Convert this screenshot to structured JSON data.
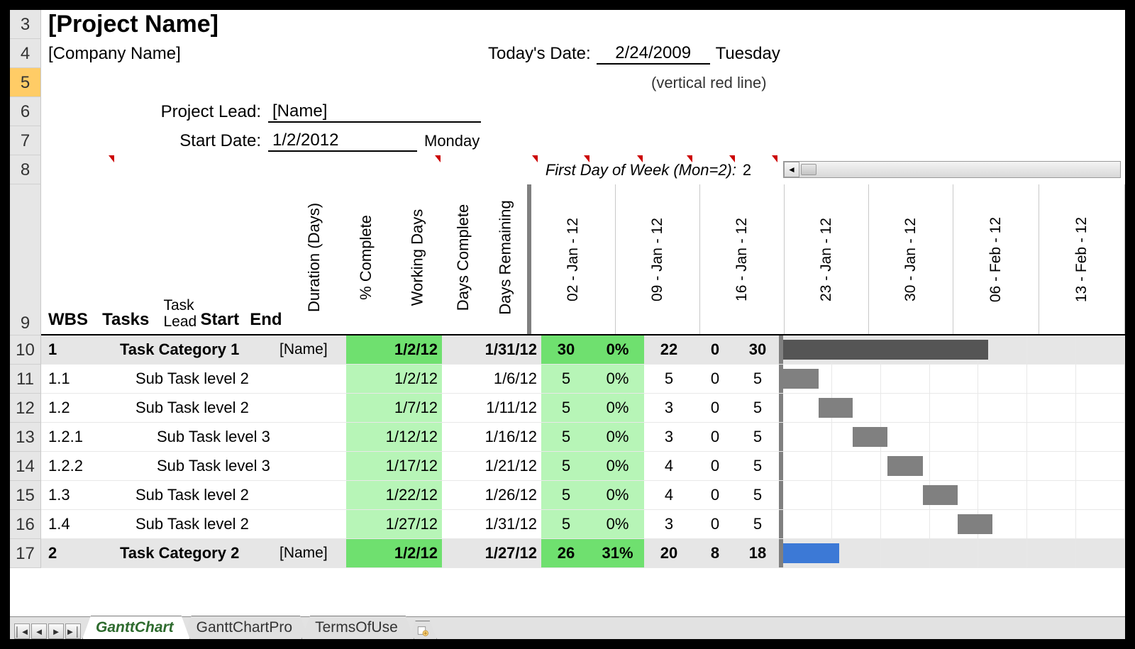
{
  "header": {
    "project_name": "[Project Name]",
    "company_name": "[Company Name]",
    "todays_date_label": "Today's Date:",
    "todays_date_value": "2/24/2009",
    "todays_date_weekday": "Tuesday",
    "todays_date_note": "(vertical red line)",
    "project_lead_label": "Project Lead:",
    "project_lead_value": "[Name]",
    "start_date_label": "Start Date:",
    "start_date_value": "1/2/2012",
    "start_date_weekday": "Monday",
    "first_day_label": "First Day of Week (Mon=2):",
    "first_day_value": "2"
  },
  "row_numbers": [
    "3",
    "4",
    "5",
    "6",
    "7",
    "8",
    "9",
    "10",
    "11",
    "12",
    "13",
    "14",
    "15",
    "16",
    "17"
  ],
  "selected_row_index": 2,
  "columns": {
    "wbs": "WBS",
    "tasks": "Tasks",
    "task_lead_1": "Task",
    "task_lead_2": "Lead",
    "start": "Start",
    "end": "End",
    "duration": "Duration (Days)",
    "pct_complete": "% Complete",
    "working_days": "Working Days",
    "days_complete": "Days Complete",
    "days_remaining": "Days Remaining"
  },
  "gantt_headers": [
    "02 - Jan - 12",
    "09 - Jan - 12",
    "16 - Jan - 12",
    "23 - Jan - 12",
    "30 - Jan - 12",
    "06 - Feb - 12",
    "13 - Feb - 12"
  ],
  "rows": [
    {
      "wbs": "1",
      "task": "Task Category 1",
      "lead": "[Name]",
      "start": "1/2/12",
      "end": "1/31/12",
      "dur": "30",
      "pct": "0%",
      "wd": "22",
      "dc": "0",
      "dr": "30",
      "category": true,
      "indent": 0,
      "bar": {
        "from": 0,
        "to": 4.2,
        "color": "dark"
      }
    },
    {
      "wbs": "1.1",
      "task": "Sub Task level 2",
      "lead": "",
      "start": "1/2/12",
      "end": "1/6/12",
      "dur": "5",
      "pct": "0%",
      "wd": "5",
      "dc": "0",
      "dr": "5",
      "category": false,
      "indent": 1,
      "bar": {
        "from": 0,
        "to": 0.72,
        "color": "gray"
      }
    },
    {
      "wbs": "1.2",
      "task": "Sub Task level 2",
      "lead": "",
      "start": "1/7/12",
      "end": "1/11/12",
      "dur": "5",
      "pct": "0%",
      "wd": "3",
      "dc": "0",
      "dr": "5",
      "category": false,
      "indent": 1,
      "bar": {
        "from": 0.72,
        "to": 1.43,
        "color": "gray"
      }
    },
    {
      "wbs": "1.2.1",
      "task": "Sub Task level 3",
      "lead": "",
      "start": "1/12/12",
      "end": "1/16/12",
      "dur": "5",
      "pct": "0%",
      "wd": "3",
      "dc": "0",
      "dr": "5",
      "category": false,
      "indent": 2,
      "bar": {
        "from": 1.43,
        "to": 2.14,
        "color": "gray"
      }
    },
    {
      "wbs": "1.2.2",
      "task": "Sub Task level 3",
      "lead": "",
      "start": "1/17/12",
      "end": "1/21/12",
      "dur": "5",
      "pct": "0%",
      "wd": "4",
      "dc": "0",
      "dr": "5",
      "category": false,
      "indent": 2,
      "bar": {
        "from": 2.14,
        "to": 2.86,
        "color": "gray"
      }
    },
    {
      "wbs": "1.3",
      "task": "Sub Task level 2",
      "lead": "",
      "start": "1/22/12",
      "end": "1/26/12",
      "dur": "5",
      "pct": "0%",
      "wd": "4",
      "dc": "0",
      "dr": "5",
      "category": false,
      "indent": 1,
      "bar": {
        "from": 2.86,
        "to": 3.57,
        "color": "gray"
      }
    },
    {
      "wbs": "1.4",
      "task": "Sub Task level 2",
      "lead": "",
      "start": "1/27/12",
      "end": "1/31/12",
      "dur": "5",
      "pct": "0%",
      "wd": "3",
      "dc": "0",
      "dr": "5",
      "category": false,
      "indent": 1,
      "bar": {
        "from": 3.57,
        "to": 4.29,
        "color": "gray"
      }
    },
    {
      "wbs": "2",
      "task": "Task Category 2",
      "lead": "[Name]",
      "start": "1/2/12",
      "end": "1/27/12",
      "dur": "26",
      "pct": "31%",
      "wd": "20",
      "dc": "8",
      "dr": "18",
      "category": true,
      "indent": 0,
      "bar": {
        "from": 0,
        "to": 1.15,
        "color": "blue"
      }
    }
  ],
  "tabs": {
    "active": "GanttChart",
    "others": [
      "GanttChartPro",
      "TermsOfUse"
    ]
  },
  "colors": {
    "green_dark": "#6fe06f",
    "green_light": "#b7f5b7",
    "bar_dark": "#555555",
    "bar_gray": "#808080",
    "bar_blue": "#3c79d6",
    "row_select": "#ffcc66"
  }
}
